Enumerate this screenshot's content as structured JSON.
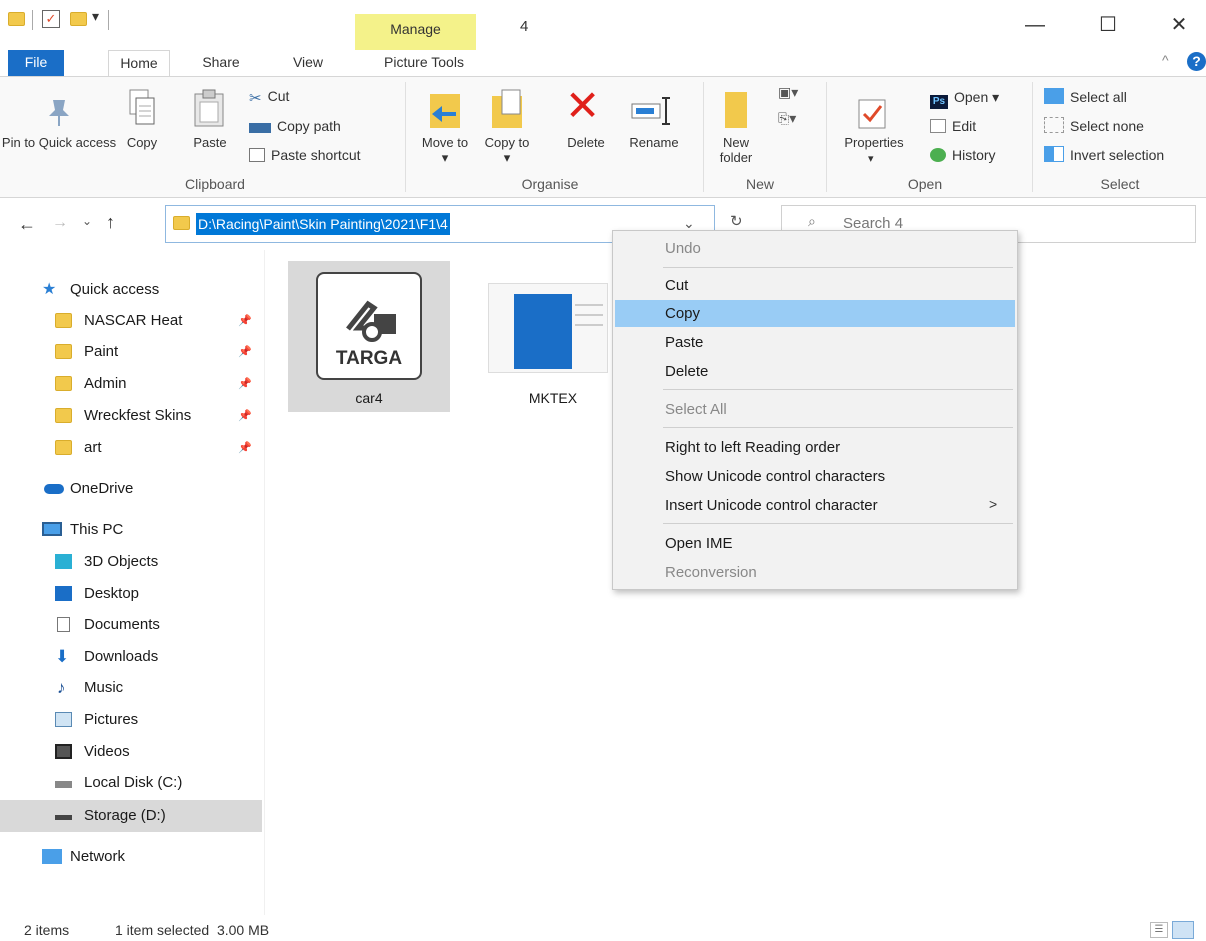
{
  "window": {
    "manage_tab": "Manage",
    "title": "4",
    "minimize": "—",
    "maximize": "☐",
    "close": "✕"
  },
  "tabs": {
    "file": "File",
    "home": "Home",
    "share": "Share",
    "view": "View",
    "picture_tools": "Picture Tools",
    "collapse": "^",
    "help": "?"
  },
  "ribbon": {
    "clipboard": {
      "group": "Clipboard",
      "pin": "Pin to Quick access",
      "copy": "Copy",
      "paste": "Paste",
      "cut": "Cut",
      "copy_path": "Copy path",
      "paste_shortcut": "Paste shortcut"
    },
    "organise": {
      "group": "Organise",
      "move_to": "Move to ▾",
      "copy_to": "Copy to ▾",
      "delete": "Delete",
      "rename": "Rename"
    },
    "new": {
      "group": "New",
      "new_folder": "New folder"
    },
    "open": {
      "group": "Open",
      "properties": "Properties",
      "open": "Open ▾",
      "edit": "Edit",
      "history": "History",
      "ps_badge": "Ps"
    },
    "select": {
      "group": "Select",
      "select_all": "Select all",
      "select_none": "Select none",
      "invert": "Invert selection"
    }
  },
  "address": {
    "path": "D:\\Racing\\Paint\\Skin Painting\\2021\\F1\\4",
    "search_placeholder": "Search 4"
  },
  "nav": {
    "quick_access": "Quick access",
    "pinned": [
      "NASCAR Heat",
      "Paint",
      "Admin",
      "Wreckfest Skins",
      "art"
    ],
    "onedrive": "OneDrive",
    "this_pc": "This PC",
    "pc_items": [
      "3D Objects",
      "Desktop",
      "Documents",
      "Downloads",
      "Music",
      "Pictures",
      "Videos",
      "Local Disk (C:)",
      "Storage (D:)"
    ],
    "network": "Network"
  },
  "files": [
    {
      "name": "car4",
      "type_label": "TARGA",
      "selected": true
    },
    {
      "name": "MKTEX",
      "selected": false
    }
  ],
  "context_menu": {
    "items": [
      {
        "label": "Undo",
        "disabled": true
      },
      {
        "label": "Cut"
      },
      {
        "label": "Copy",
        "highlighted": true
      },
      {
        "label": "Paste"
      },
      {
        "label": "Delete"
      },
      {
        "label": "Select All",
        "disabled": true
      },
      {
        "label": "Right to left Reading order"
      },
      {
        "label": "Show Unicode control characters"
      },
      {
        "label": "Insert Unicode control character",
        "submenu_arrow": ">"
      },
      {
        "label": "Open IME"
      },
      {
        "label": "Reconversion",
        "disabled": true
      }
    ]
  },
  "status": {
    "items": "2 items",
    "selection": "1 item selected  3.00 MB"
  },
  "colors": {
    "accent": "#0078d7",
    "file_tab": "#1a6ec7",
    "manage_tab": "#f4f28a",
    "menu_highlight": "#99ccf5",
    "folder": "#f2c94c"
  }
}
